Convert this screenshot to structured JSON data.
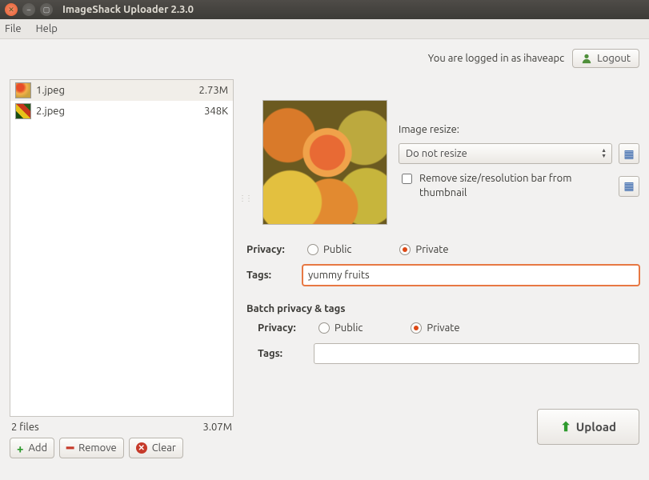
{
  "window": {
    "title": "ImageShack Uploader 2.3.0"
  },
  "menubar": {
    "file": "File",
    "help": "Help"
  },
  "login": {
    "status": "You are logged in as ihaveapc",
    "logout": "Logout"
  },
  "files": {
    "items": [
      {
        "name": "1.jpeg",
        "size": "2.73M",
        "selected": true,
        "thumb": "apples"
      },
      {
        "name": "2.jpeg",
        "size": "348K",
        "selected": false,
        "thumb": "flowers"
      }
    ],
    "summary_count": "2 files",
    "summary_size": "3.07M"
  },
  "filebuttons": {
    "add": "Add",
    "remove": "Remove",
    "clear": "Clear"
  },
  "resize": {
    "label": "Image resize:",
    "value": "Do not resize",
    "remove_bar_label": "Remove size/resolution bar from thumbnail",
    "remove_bar_checked": false
  },
  "privacy": {
    "label": "Privacy:",
    "public": "Public",
    "private": "Private",
    "selected": "private"
  },
  "tags": {
    "label": "Tags:",
    "value": "yummy fruits"
  },
  "batch": {
    "title": "Batch privacy & tags",
    "privacy": {
      "label": "Privacy:",
      "public": "Public",
      "private": "Private",
      "selected": "private"
    },
    "tags": {
      "label": "Tags:",
      "value": ""
    }
  },
  "upload": {
    "label": "Upload"
  }
}
